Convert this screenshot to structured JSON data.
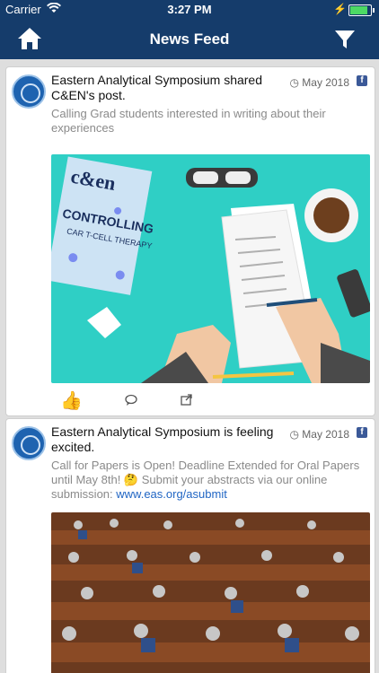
{
  "status_bar": {
    "carrier": "Carrier",
    "time": "3:27 PM"
  },
  "nav": {
    "title": "News Feed"
  },
  "posts": [
    {
      "author_text": "Eastern Analytical Symposium shared C&EN's post.",
      "date": "May 2018",
      "body": "Calling Grad students interested in writing about their experiences",
      "image_text": {
        "magazine": "c&en",
        "headline": "CONTROLLING",
        "sub": "CAR T-CELL THERAPY"
      }
    },
    {
      "author_text": "Eastern Analytical Symposium is feeling excited.",
      "date": "May 2018",
      "body": "Call for Papers is Open! Deadline Extended for Oral Papers until May 8th! 🤔 Submit your abstracts via our online submission:",
      "link": "www.eas.org/asubmit"
    }
  ],
  "colors": {
    "nav_bg": "#153c6b",
    "card_bg": "#ffffff",
    "feed_bg": "#dedede",
    "illustration_bg": "#2fcfc5"
  }
}
